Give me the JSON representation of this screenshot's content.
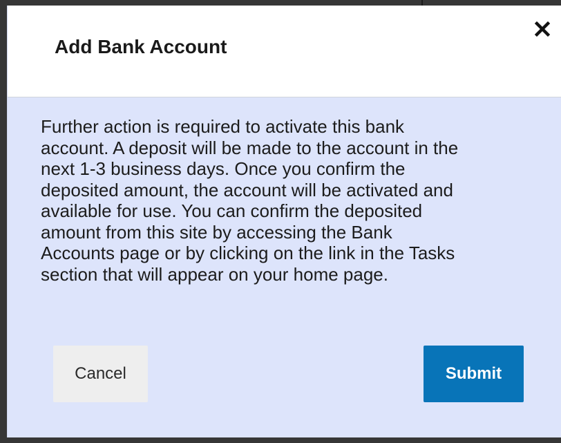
{
  "dialog": {
    "title": "Add Bank Account",
    "close_icon": "close-icon",
    "body_lines": [
      "Further action is required to activate this bank",
      "account. A deposit will be made to the account in the",
      "next 1-3 business days. Once you confirm the",
      "deposited amount, the account will be activated and",
      "available for use. You can confirm the deposited",
      "amount from this site by accessing the Bank",
      "Accounts page or by clicking on the link in the Tasks",
      "section that will appear on your home page."
    ],
    "buttons": {
      "cancel_label": "Cancel",
      "submit_label": "Submit"
    }
  },
  "colors": {
    "body_background": "#dde4fb",
    "header_background": "#ffffff",
    "submit_background": "#0874b8",
    "cancel_background": "#eeeeee"
  }
}
